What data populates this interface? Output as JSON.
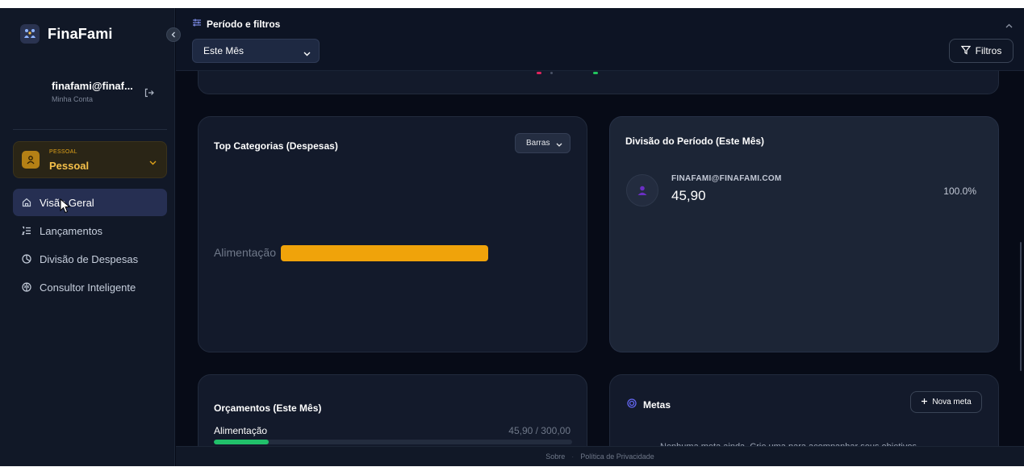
{
  "app": {
    "name": "FinaFami"
  },
  "user": {
    "email": "finafami@finaf...",
    "subtitle": "Minha Conta"
  },
  "account": {
    "kicker": "PESSOAL",
    "name": "Pessoal"
  },
  "nav": {
    "items": [
      {
        "label": "Visão Geral",
        "icon": "home-icon",
        "active": true
      },
      {
        "label": "Lançamentos",
        "icon": "list-icon",
        "active": false
      },
      {
        "label": "Divisão de Despesas",
        "icon": "pie-icon",
        "active": false
      },
      {
        "label": "Consultor Inteligente",
        "icon": "brain-icon",
        "active": false
      }
    ]
  },
  "filters": {
    "title": "Período e filtros",
    "period_value": "Este Mês",
    "filters_label": "Filtros"
  },
  "top_categories": {
    "title": "Top Categorias (Despesas)",
    "chart_type_label": "Barras"
  },
  "chart_data": {
    "type": "bar",
    "orientation": "horizontal",
    "categories": [
      "Alimentação"
    ],
    "values": [
      45.9
    ],
    "color": "#f0a30a"
  },
  "period_split": {
    "title": "Divisão do Período (Este Mês)",
    "member_name": "FINAFAMI@FINAFAMI.COM",
    "member_value": "45,90",
    "member_percent": "100.0%"
  },
  "budgets": {
    "title": "Orçamentos (Este Mês)",
    "rows": [
      {
        "label": "Alimentação",
        "value": "45,90 / 300,00",
        "progress": 0.153
      }
    ]
  },
  "goals": {
    "title": "Metas",
    "new_goal_label": "Nova meta",
    "empty_text": "Nenhuma meta ainda. Crie uma para acompanhar seus objetivos"
  },
  "footer": {
    "about": "Sobre",
    "privacy": "Política de Privacidade"
  },
  "colors": {
    "accent_orange": "#f0a30a",
    "progress_green": "#21c06a",
    "active_nav": "#262f52",
    "goal_icon": "#6366f1"
  }
}
